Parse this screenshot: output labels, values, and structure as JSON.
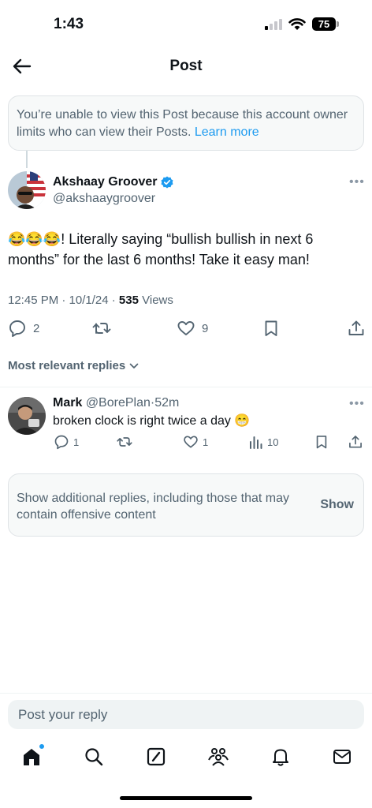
{
  "status": {
    "time": "1:43",
    "battery": "75"
  },
  "header": {
    "title": "Post"
  },
  "notice": {
    "text": "You’re unable to view this Post because this account owner limits who can view their Posts.",
    "link": "Learn more"
  },
  "post": {
    "author_name": "Akshaay Groover",
    "author_handle": "@akshaaygroover",
    "emojis": "😂😂😂",
    "text": "! Literally saying “bullish bullish in next 6 months” for the last 6 months! Take it easy man!",
    "time": "12:45 PM · 10/1/24 ·",
    "views_count": "535",
    "views_label": "Views",
    "replies": "2",
    "likes": "9"
  },
  "sort": {
    "label": "Most relevant replies"
  },
  "reply": {
    "name": "Mark",
    "handle": "@BorePlan",
    "time": "52m",
    "text": "broken clock is right twice a day",
    "emoji": "😁",
    "replies": "1",
    "likes": "1",
    "views": "10"
  },
  "sensitive": {
    "text": "Show additional replies, including those that may contain offensive content",
    "button": "Show"
  },
  "composer": {
    "placeholder": "Post your reply"
  },
  "colors": {
    "accent": "#1d9bf0",
    "muted": "#536471"
  }
}
